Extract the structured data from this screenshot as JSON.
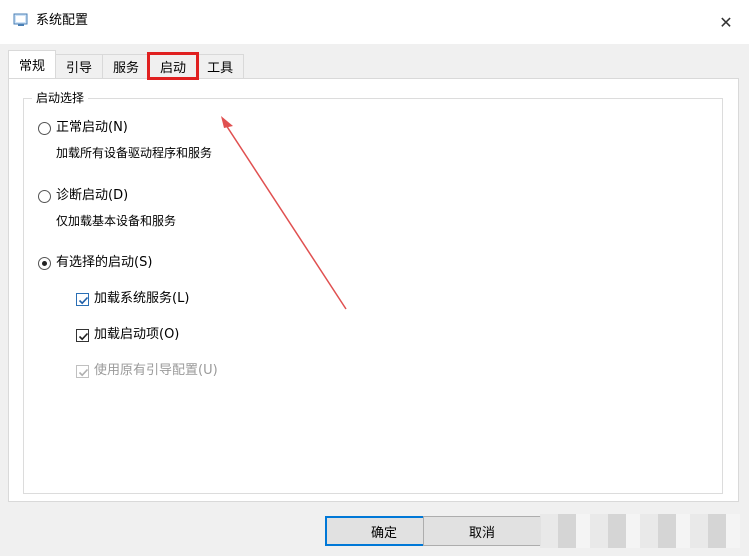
{
  "window": {
    "title": "系统配置",
    "close_glyph": "✕"
  },
  "tabs": [
    {
      "label": "常规"
    },
    {
      "label": "引导"
    },
    {
      "label": "服务"
    },
    {
      "label": "启动"
    },
    {
      "label": "工具"
    }
  ],
  "startup_group": {
    "legend": "启动选择",
    "normal": {
      "label": "正常启动(N)",
      "desc": "加载所有设备驱动程序和服务",
      "selected": false
    },
    "diagnostic": {
      "label": "诊断启动(D)",
      "desc": "仅加载基本设备和服务",
      "selected": false
    },
    "selective": {
      "label": "有选择的启动(S)",
      "selected": true
    },
    "options": [
      {
        "label": "加载系统服务(L)",
        "checked": true
      },
      {
        "label": "加载启动项(O)",
        "checked": true
      },
      {
        "label": "使用原有引导配置(U)",
        "checked": true,
        "disabled": true
      }
    ]
  },
  "buttons": {
    "ok": "确定",
    "cancel": "取消"
  },
  "colors": {
    "highlight": "#e02020",
    "arrow": "#e05050",
    "default_button_border": "#0078d7"
  }
}
